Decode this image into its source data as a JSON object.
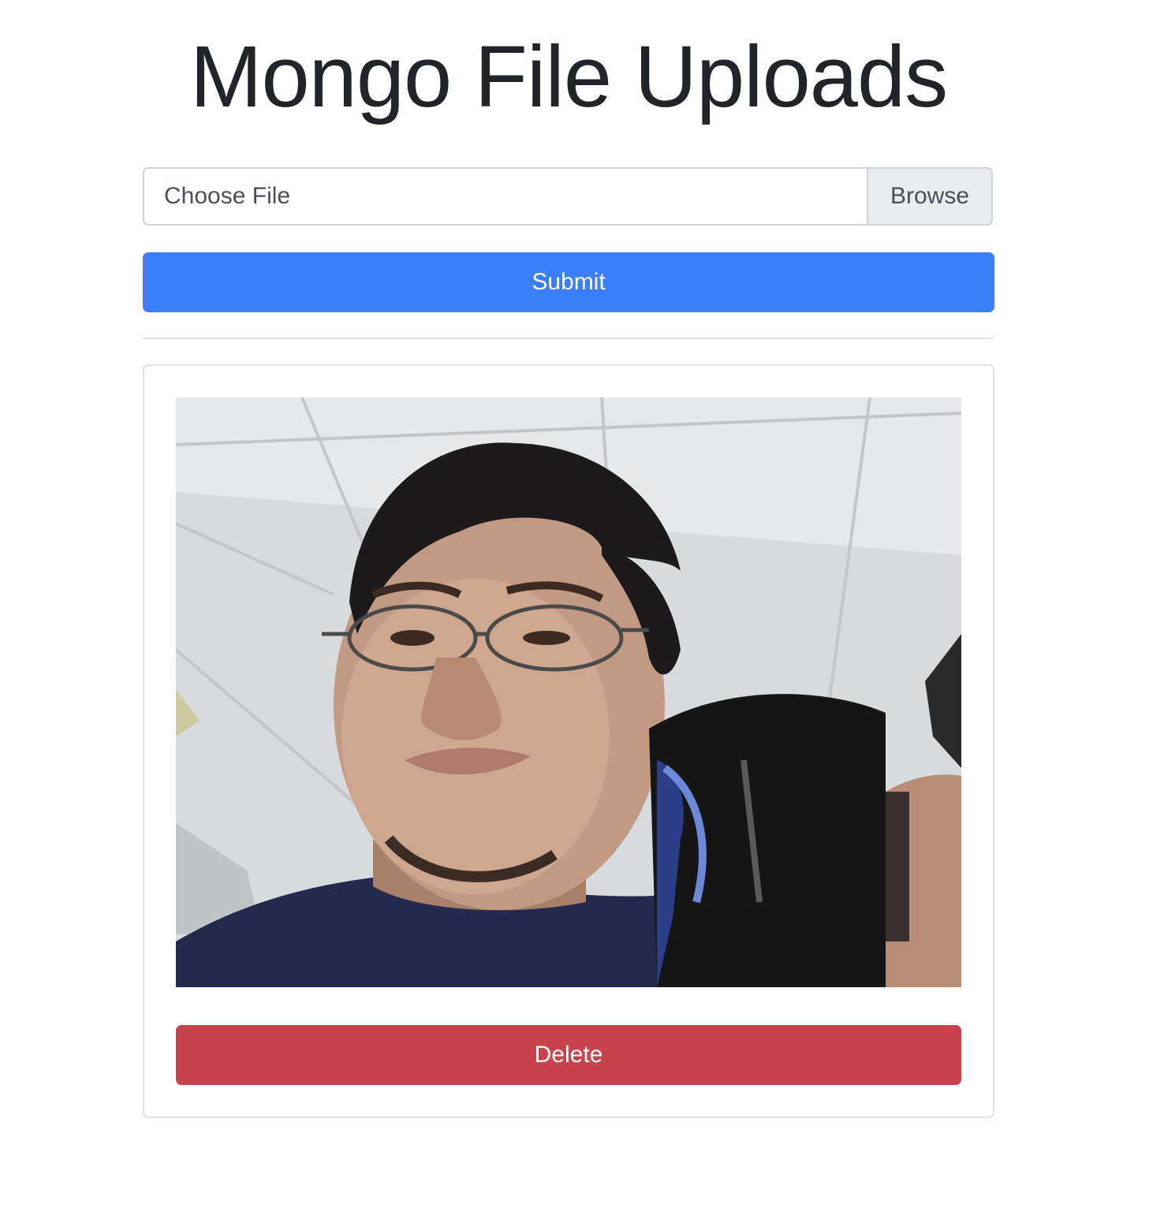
{
  "page": {
    "title": "Mongo File Uploads"
  },
  "upload_form": {
    "file_label": "Choose File",
    "browse_label": "Browse",
    "submit_label": "Submit"
  },
  "files": [
    {
      "image_alt": "uploaded photo",
      "delete_label": "Delete"
    }
  ],
  "colors": {
    "primary": "#3b7ef6",
    "danger": "#c9434c",
    "border": "#ced4da",
    "browse_bg": "#e9ecef"
  }
}
